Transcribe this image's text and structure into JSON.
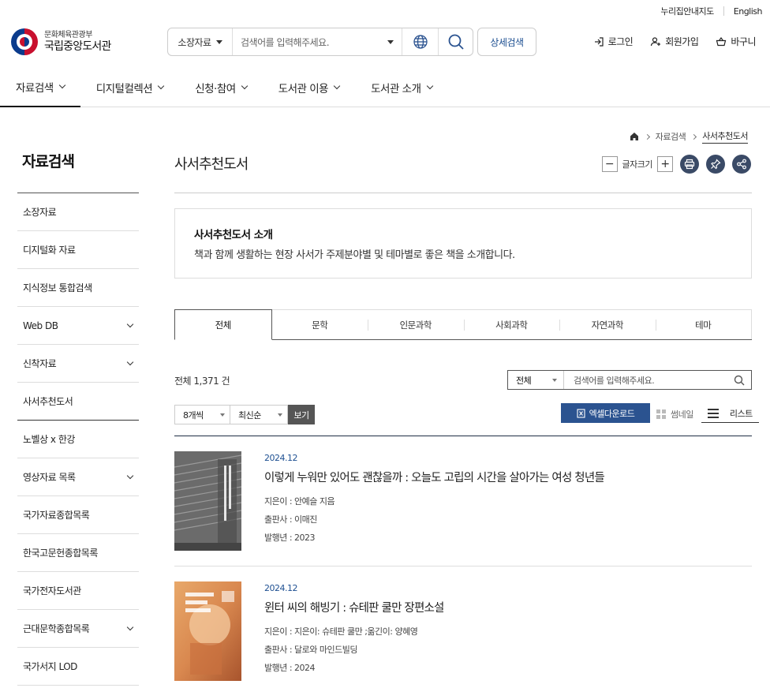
{
  "util": {
    "sitemap": "누리집안내지도",
    "english": "English"
  },
  "logo": {
    "ministry": "문화체육관광부",
    "name": "국립중앙도서관"
  },
  "search": {
    "scope": "소장자료",
    "placeholder": "검색어를 입력해주세요.",
    "advanced": "상세검색"
  },
  "header_links": {
    "login": "로그인",
    "join": "회원가입",
    "cart": "바구니"
  },
  "gnb": [
    "자료검색",
    "디지털컬렉션",
    "신청·참여",
    "도서관 이용",
    "도서관 소개"
  ],
  "sidebar": {
    "title": "자료검색",
    "items": [
      {
        "label": "소장자료",
        "expand": false
      },
      {
        "label": "디지털화 자료",
        "expand": false
      },
      {
        "label": "지식정보 통합검색",
        "expand": false
      },
      {
        "label": "Web DB",
        "expand": true
      },
      {
        "label": "신착자료",
        "expand": true
      },
      {
        "label": "사서추천도서",
        "expand": false,
        "active": true
      },
      {
        "label": "노벨상 x 한강",
        "expand": false
      },
      {
        "label": "영상자료 목록",
        "expand": true
      },
      {
        "label": "국가자료종합목록",
        "expand": false
      },
      {
        "label": "한국고문헌종합목록",
        "expand": false
      },
      {
        "label": "국가전자도서관",
        "expand": false
      },
      {
        "label": "근대문학종합목록",
        "expand": true
      },
      {
        "label": "국가서지 LOD",
        "expand": false
      }
    ]
  },
  "breadcrumb": {
    "level1": "자료검색",
    "current": "사서추천도서"
  },
  "page": {
    "title": "사서추천도서",
    "font_size_label": "글자크기",
    "minus": "−",
    "plus": "+"
  },
  "intro": {
    "heading": "사서추천도서 소개",
    "text": "책과 함께 생활하는 현장 사서가 주제분야별 및 테마별로 좋은 책을 소개합니다."
  },
  "tabs": [
    "전체",
    "문학",
    "인문과학",
    "사회과학",
    "자연과학",
    "테마"
  ],
  "list": {
    "total": "전체 1,371 건",
    "search_scope": "전체",
    "search_placeholder": "검색어를 입력해주세요.",
    "per_page": "8개씩",
    "sort": "최신순",
    "view_btn": "보기",
    "excel": "엑셀다운로드",
    "thumb": "썸네일",
    "listview": "리스트"
  },
  "books": [
    {
      "date": "2024.12",
      "title": "이렇게 누워만 있어도 괜찮을까 : 오늘도 고립의 시간을 살아가는 여성 청년들",
      "author": "지은이 : 안예슬 지음",
      "publisher": "출판사 : 이매진",
      "year": "발행년 : 2023"
    },
    {
      "date": "2024.12",
      "title": "윈터 씨의 해빙기 : 슈테판 쿨만 장편소설",
      "author": "지은이 : 지은이: 슈테판 쿨만 ;옮긴이: 양혜영",
      "publisher": "출판사 : 달로와 마인드빌딩",
      "year": "발행년 : 2024"
    }
  ]
}
